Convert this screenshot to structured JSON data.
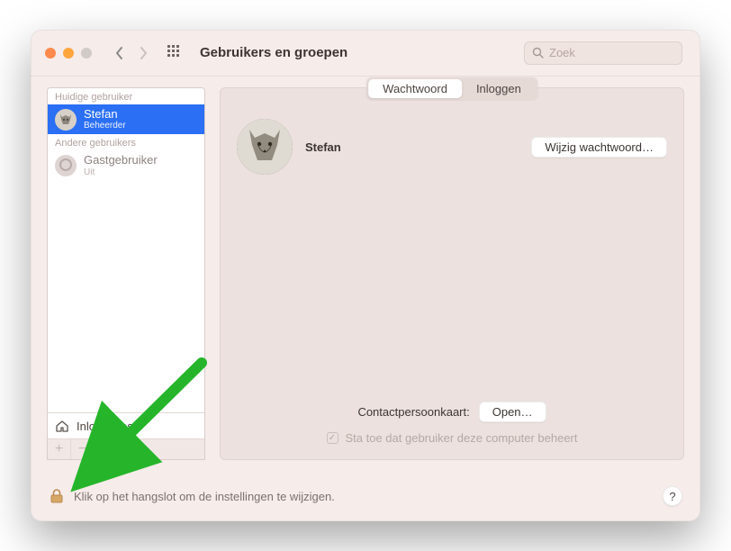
{
  "window": {
    "title": "Gebruikers en groepen",
    "search_placeholder": "Zoek"
  },
  "sidebar": {
    "current_header": "Huidige gebruiker",
    "current_user": {
      "name": "Stefan",
      "role": "Beheerder"
    },
    "other_header": "Andere gebruikers",
    "guest_user": {
      "name": "Gastgebruiker",
      "status": "Uit"
    },
    "login_options_label": "Inlogopties"
  },
  "tabs": {
    "password": "Wachtwoord",
    "login": "Inloggen"
  },
  "main": {
    "user_name": "Stefan",
    "change_password_btn": "Wijzig wachtwoord…",
    "contact_card_label": "Contactpersoonkaart:",
    "open_btn": "Open…",
    "admin_checkbox_label": "Sta toe dat gebruiker deze computer beheert"
  },
  "footer": {
    "lock_text": "Klik op het hangslot om de instellingen te wijzigen.",
    "help": "?"
  }
}
